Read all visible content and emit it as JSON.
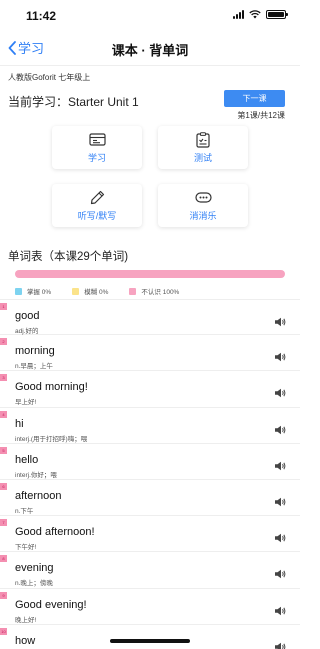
{
  "status": {
    "time": "11:42"
  },
  "nav": {
    "back_label": "学习",
    "title": "课本 · 背单词"
  },
  "book": {
    "name": "人教版Goforit 七年级上"
  },
  "current": {
    "label": "当前学习：Starter Unit 1",
    "next_label": "下一课",
    "lesson_count": "第1课/共12课"
  },
  "features": [
    {
      "label": "学习",
      "icon": "study-icon"
    },
    {
      "label": "测试",
      "icon": "test-icon"
    },
    {
      "label": "听写/默写",
      "icon": "pen-icon"
    },
    {
      "label": "消消乐",
      "icon": "game-icon"
    }
  ],
  "wordlist": {
    "title": "单词表（本课29个单词)",
    "progress": {
      "mastered_pct": 0,
      "fuzzy_pct": 0,
      "unknown_pct": 100
    },
    "legend": [
      {
        "label": "掌握 0%",
        "color": "#7dd3f0"
      },
      {
        "label": "模糊 0%",
        "color": "#fbe38a"
      },
      {
        "label": "不认识 100%",
        "color": "#f7a3c0"
      }
    ],
    "words": [
      {
        "word": "good",
        "def": "adj.好的",
        "marker": "1"
      },
      {
        "word": "morning",
        "def": "n.早晨；上午",
        "marker": "2"
      },
      {
        "word": "Good morning!",
        "def": "早上好!",
        "marker": "3"
      },
      {
        "word": "hi",
        "def": "interj.(用于打招呼)嗨；喂",
        "marker": "4"
      },
      {
        "word": "hello",
        "def": "interj.你好；喂",
        "marker": "5"
      },
      {
        "word": "afternoon",
        "def": "n.下午",
        "marker": "6"
      },
      {
        "word": "Good afternoon!",
        "def": "下午好!",
        "marker": "7"
      },
      {
        "word": "evening",
        "def": "n.晚上；傍晚",
        "marker": "8"
      },
      {
        "word": "Good evening!",
        "def": "晚上好!",
        "marker": "9"
      },
      {
        "word": "how",
        "def": "",
        "marker": "10"
      }
    ]
  },
  "colors": {
    "accent": "#2f7ff5",
    "button": "#3d8bf2",
    "unknown": "#f7a3c0"
  }
}
